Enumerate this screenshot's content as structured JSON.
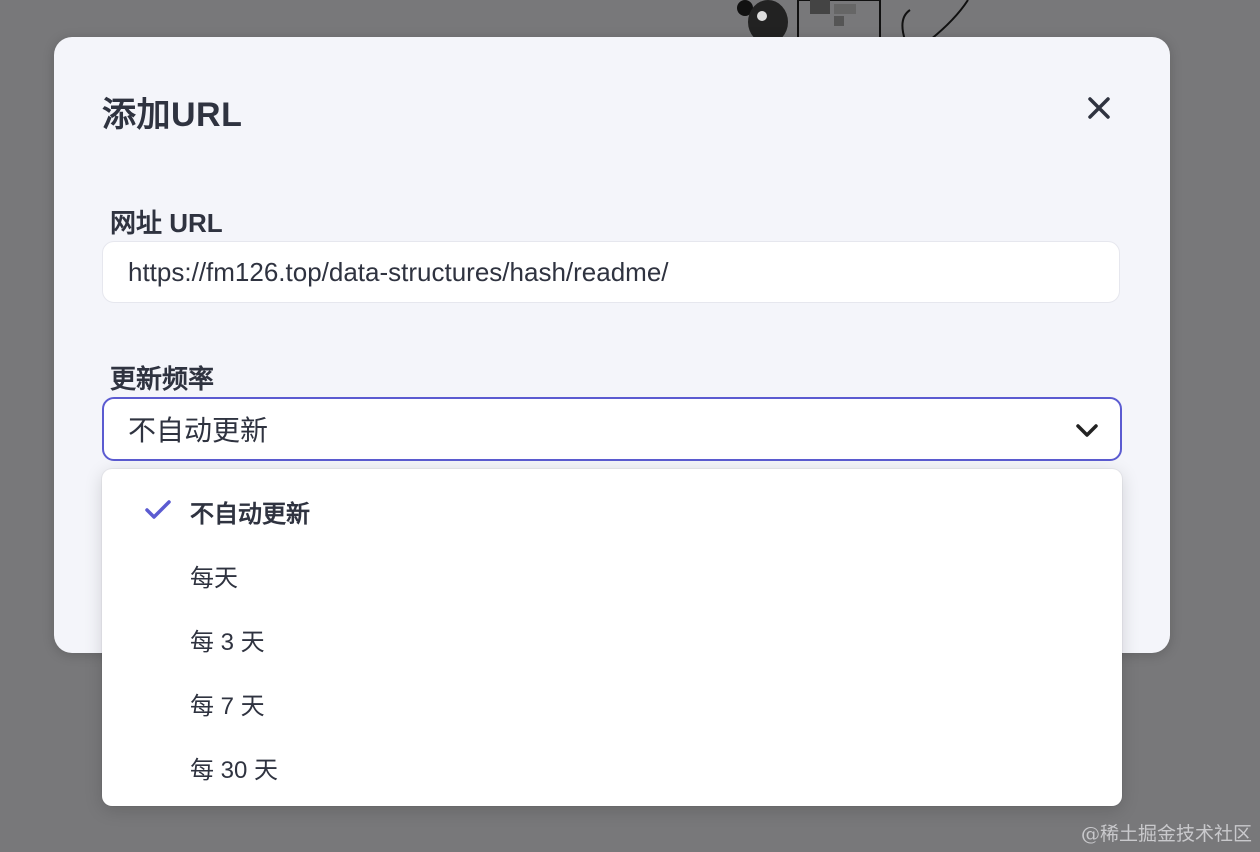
{
  "modal": {
    "title": "添加URL",
    "close_icon": "close-icon"
  },
  "url_field": {
    "label": "网址 URL",
    "value": "https://fm126.top/data-structures/hash/readme/"
  },
  "frequency_field": {
    "label": "更新频率",
    "selected_value": "不自动更新",
    "chevron_icon": "chevron-down-icon",
    "options": [
      {
        "label": "不自动更新",
        "selected": true
      },
      {
        "label": "每天",
        "selected": false
      },
      {
        "label": "每 3 天",
        "selected": false
      },
      {
        "label": "每 7 天",
        "selected": false
      },
      {
        "label": "每 30 天",
        "selected": false
      }
    ]
  },
  "colors": {
    "accent": "#5b5bd1",
    "text": "#2f3340",
    "modal_bg": "#f4f5fa",
    "backdrop": "#78787a"
  },
  "watermark": "@稀土掘金技术社区"
}
